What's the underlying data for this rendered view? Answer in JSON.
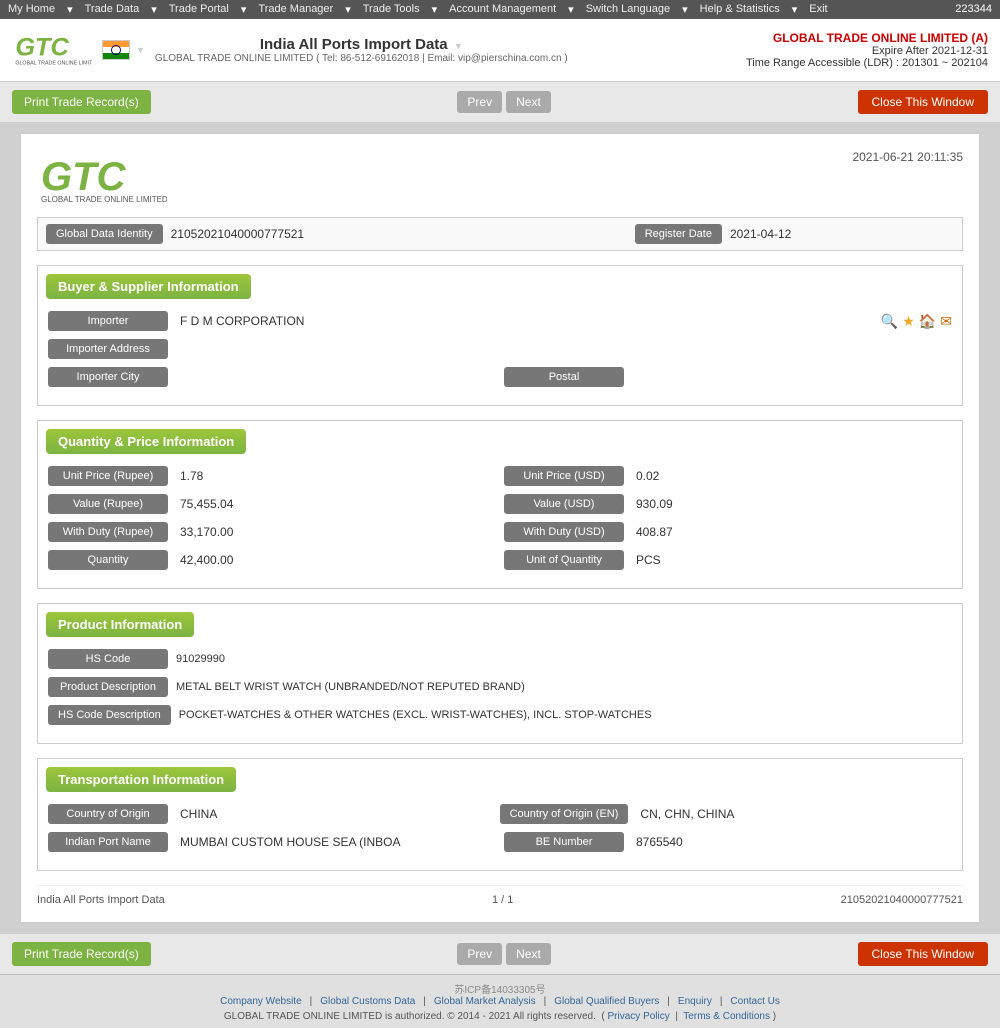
{
  "topbar": {
    "nav_items": [
      "My Home",
      "Trade Data",
      "Trade Portal",
      "Trade Manager",
      "Trade Tools",
      "Account Management",
      "Switch Language",
      "Help & Statistics",
      "Exit"
    ],
    "account_num": "223344"
  },
  "header": {
    "title": "India All Ports Import Data",
    "subtitle": "GLOBAL TRADE ONLINE LIMITED ( Tel: 86-512-69162018 | Email: vip@pierschina.com.cn )",
    "company_name": "GLOBAL TRADE ONLINE LIMITED (A)",
    "expire": "Expire After 2021-12-31",
    "time_range": "Time Range Accessible (LDR) : 201301 ~ 202104",
    "dropdown_arrow": "▼"
  },
  "toolbar": {
    "print_label": "Print Trade Record(s)",
    "prev_label": "Prev",
    "next_label": "Next",
    "close_label": "Close This Window"
  },
  "record": {
    "datetime": "2021-06-21 20:11:35",
    "global_data_identity_label": "Global Data Identity",
    "global_data_identity_value": "21052021040000777521",
    "register_date_label": "Register Date",
    "register_date_value": "2021-04-12",
    "sections": {
      "buyer_supplier": {
        "header": "Buyer & Supplier Information",
        "importer_label": "Importer",
        "importer_value": "F D M CORPORATION",
        "importer_address_label": "Importer Address",
        "importer_address_value": "",
        "importer_city_label": "Importer City",
        "importer_city_value": "",
        "postal_label": "Postal",
        "postal_value": ""
      },
      "quantity_price": {
        "header": "Quantity & Price Information",
        "fields": [
          {
            "label": "Unit Price (Rupee)",
            "value": "1.78",
            "col": "left"
          },
          {
            "label": "Unit Price (USD)",
            "value": "0.02",
            "col": "right"
          },
          {
            "label": "Value (Rupee)",
            "value": "75,455.04",
            "col": "left"
          },
          {
            "label": "Value (USD)",
            "value": "930.09",
            "col": "right"
          },
          {
            "label": "With Duty (Rupee)",
            "value": "33,170.00",
            "col": "left"
          },
          {
            "label": "With Duty (USD)",
            "value": "408.87",
            "col": "right"
          },
          {
            "label": "Quantity",
            "value": "42,400.00",
            "col": "left"
          },
          {
            "label": "Unit of Quantity",
            "value": "PCS",
            "col": "right"
          }
        ]
      },
      "product": {
        "header": "Product Information",
        "hs_code_label": "HS Code",
        "hs_code_value": "91029990",
        "product_desc_label": "Product Description",
        "product_desc_value": "METAL BELT WRIST WATCH (UNBRANDED/NOT REPUTED BRAND)",
        "hs_code_desc_label": "HS Code Description",
        "hs_code_desc_value": "POCKET-WATCHES & OTHER WATCHES (EXCL. WRIST-WATCHES), INCL. STOP-WATCHES"
      },
      "transportation": {
        "header": "Transportation Information",
        "country_origin_label": "Country of Origin",
        "country_origin_value": "CHINA",
        "country_origin_en_label": "Country of Origin (EN)",
        "country_origin_en_value": "CN, CHN, CHINA",
        "indian_port_label": "Indian Port Name",
        "indian_port_value": "MUMBAI CUSTOM HOUSE SEA (INBOA",
        "be_number_label": "BE Number",
        "be_number_value": "8765540"
      }
    },
    "footer": {
      "left": "India All Ports Import Data",
      "center": "1 / 1",
      "right": "21052021040000777521"
    }
  },
  "site_footer": {
    "beian": "苏ICP备14033305号",
    "links": [
      "Company Website",
      "Global Customs Data",
      "Global Market Analysis",
      "Global Qualified Buyers",
      "Enquiry",
      "Contact Us"
    ],
    "copyright": "GLOBAL TRADE ONLINE LIMITED is authorized. © 2014 - 2021 All rights reserved.",
    "policy": "Privacy Policy",
    "terms": "Terms & Conditions"
  }
}
